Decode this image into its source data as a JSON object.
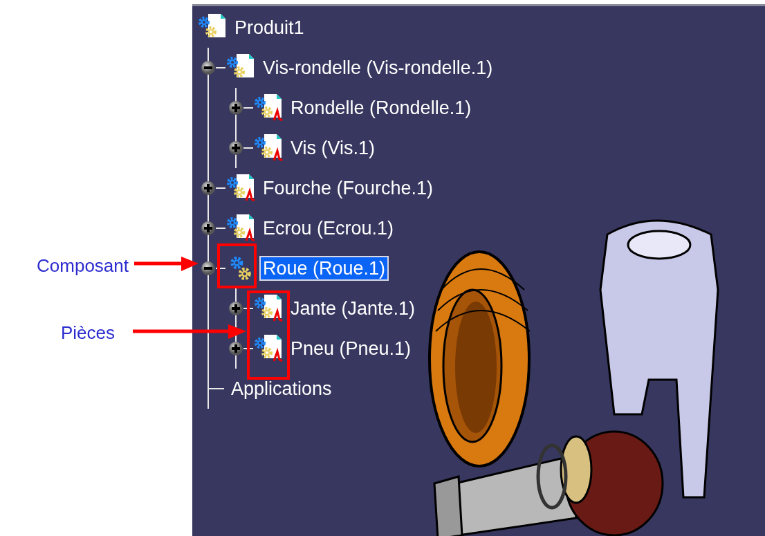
{
  "callouts": [
    {
      "label": "Composant"
    },
    {
      "label": "Pièces"
    }
  ],
  "tree": {
    "label": "Produit1",
    "kind": "product",
    "selected": false,
    "children": [
      {
        "label": "Vis-rondelle (Vis-rondelle.1)",
        "kind": "product",
        "expanded": true,
        "selected": false,
        "children": [
          {
            "label": "Rondelle (Rondelle.1)",
            "kind": "part",
            "expanded": false,
            "selected": false
          },
          {
            "label": "Vis (Vis.1)",
            "kind": "part",
            "expanded": false,
            "selected": false
          }
        ]
      },
      {
        "label": "Fourche (Fourche.1)",
        "kind": "part",
        "expanded": false,
        "selected": false
      },
      {
        "label": "Ecrou (Ecrou.1)",
        "kind": "part",
        "expanded": false,
        "selected": false
      },
      {
        "label": "Roue (Roue.1)",
        "kind": "component",
        "expanded": true,
        "selected": true,
        "children": [
          {
            "label": "Jante (Jante.1)",
            "kind": "part",
            "expanded": false,
            "selected": false
          },
          {
            "label": "Pneu (Pneu.1)",
            "kind": "part",
            "expanded": false,
            "selected": false
          }
        ]
      },
      {
        "label": "Applications",
        "kind": "node",
        "selected": false
      }
    ]
  }
}
